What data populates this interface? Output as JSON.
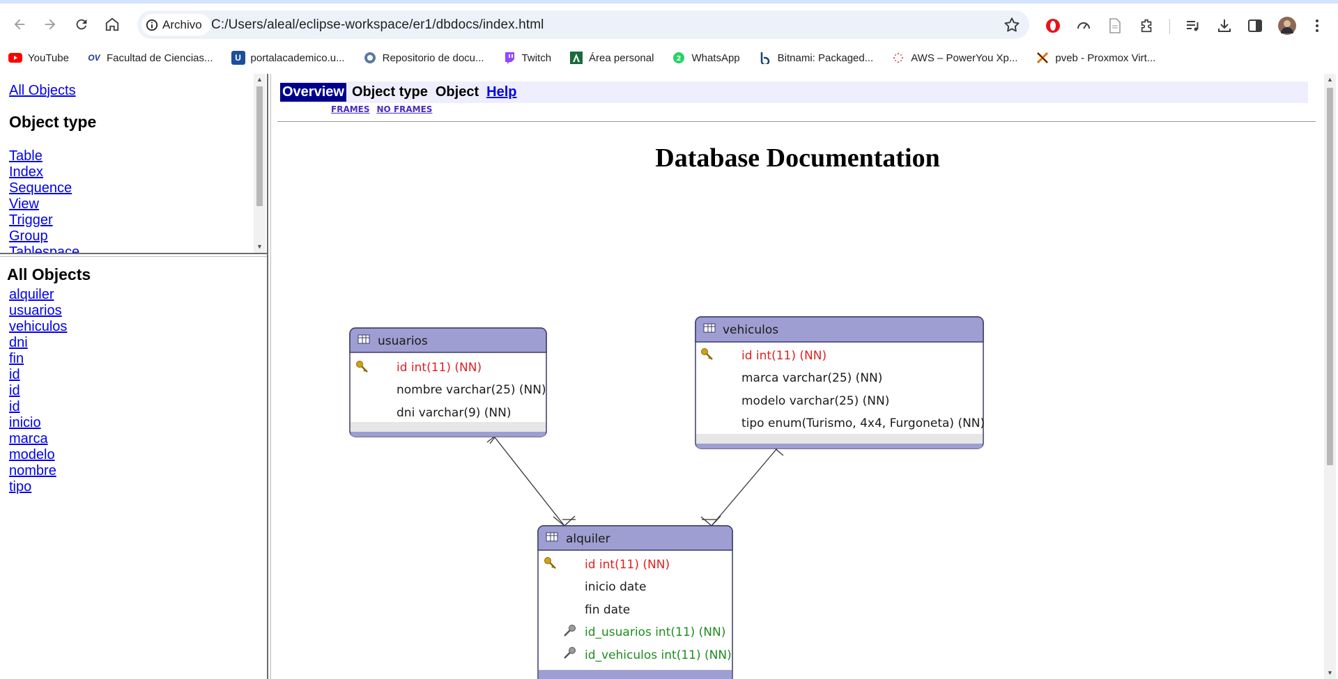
{
  "browser": {
    "site_chip_label": "Archivo",
    "url": "C:/Users/aleal/eclipse-workspace/er1/dbdocs/index.html",
    "bookmarks": [
      {
        "label": "YouTube",
        "icon": "youtube-icon",
        "color": "#ff0000"
      },
      {
        "label": "Facultad de Ciencias...",
        "icon": "ov-logo-icon",
        "color": "#1a3a8a"
      },
      {
        "label": "portalacademico.u...",
        "icon": "u-logo-icon",
        "color": "#1b4f9c"
      },
      {
        "label": "Repositorio de docu...",
        "icon": "repository-icon",
        "color": "#5a7aa0"
      },
      {
        "label": "Twitch",
        "icon": "twitch-icon",
        "color": "#9146ff"
      },
      {
        "label": "Área personal",
        "icon": "moodle-a-icon",
        "color": "#1a6b3a"
      },
      {
        "label": "WhatsApp",
        "icon": "whatsapp-icon",
        "color": "#25d366"
      },
      {
        "label": "Bitnami: Packaged...",
        "icon": "bitnami-icon",
        "color": "#1a3e7a"
      },
      {
        "label": "AWS – PowerYou Xp...",
        "icon": "aws-dots-icon",
        "color": "#e07a3a"
      },
      {
        "label": "pveb - Proxmox Virt...",
        "icon": "proxmox-icon",
        "color": "#e57000"
      }
    ]
  },
  "types_frame": {
    "all_objects_link": "All Objects",
    "heading": "Object type",
    "items": [
      "Table",
      "Index",
      "Sequence",
      "View",
      "Trigger",
      "Group",
      "Tablespace"
    ]
  },
  "objects_frame": {
    "heading": "All Objects",
    "items": [
      "alquiler ",
      "usuarios ",
      "vehiculos ",
      "dni ",
      "fin ",
      "id ",
      "id ",
      "id ",
      "inicio ",
      "marca ",
      "modelo ",
      "nombre ",
      "tipo "
    ]
  },
  "main": {
    "nav": {
      "overview": "Overview",
      "object_type": "Object type",
      "object": "Object",
      "help": "Help"
    },
    "subnav": {
      "frames": "FRAMES",
      "no_frames": "NO FRAMES"
    },
    "title": "Database Documentation",
    "er": {
      "colors": {
        "header": "#9e9ed2",
        "pk": "#e02020",
        "fk": "#1e8c1e",
        "border": "#3a3a6a"
      },
      "tables": [
        {
          "name": "usuarios",
          "columns": [
            {
              "text": "id int(11) (NN)",
              "kind": "pk"
            },
            {
              "text": "nombre varchar(25) (NN)",
              "kind": "normal"
            },
            {
              "text": "dni varchar(9) (NN)",
              "kind": "normal"
            }
          ]
        },
        {
          "name": "vehiculos",
          "columns": [
            {
              "text": "id int(11) (NN)",
              "kind": "pk"
            },
            {
              "text": "marca varchar(25) (NN)",
              "kind": "normal"
            },
            {
              "text": "modelo varchar(25) (NN)",
              "kind": "normal"
            },
            {
              "text": "tipo enum(Turismo, 4x4, Furgoneta) (NN)",
              "kind": "normal"
            }
          ]
        },
        {
          "name": "alquiler",
          "columns": [
            {
              "text": "id int(11) (NN)",
              "kind": "pk"
            },
            {
              "text": "inicio date",
              "kind": "normal"
            },
            {
              "text": "fin date",
              "kind": "normal"
            },
            {
              "text": "id_usuarios int(11) (NN)",
              "kind": "fk"
            },
            {
              "text": "id_vehiculos int(11) (NN)",
              "kind": "fk"
            }
          ]
        }
      ]
    }
  }
}
